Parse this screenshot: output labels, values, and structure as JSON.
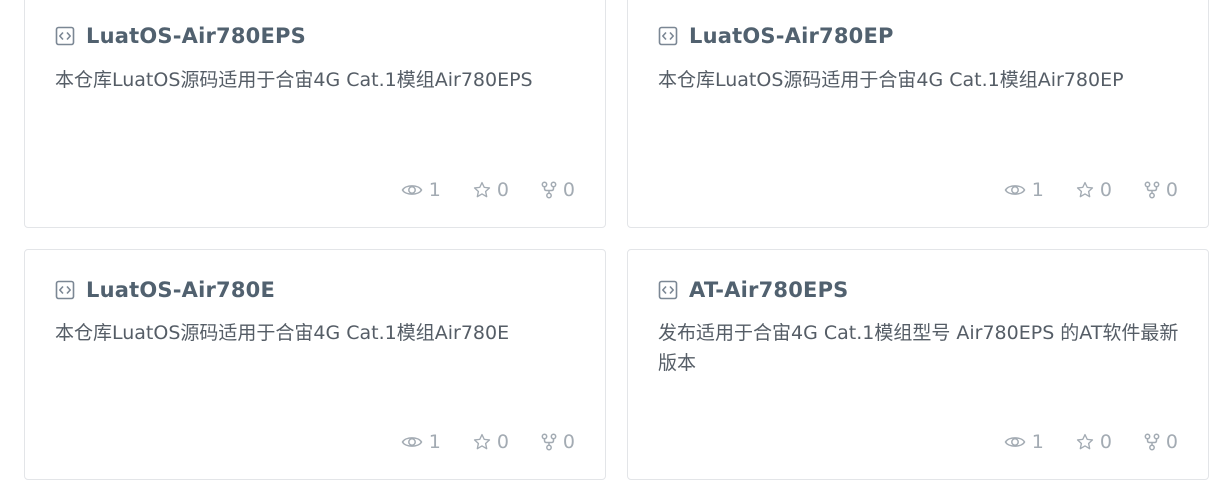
{
  "repos": [
    {
      "name": "LuatOS-Air780EPS",
      "description": "本仓库LuatOS源码适用于合宙4G Cat.1模组Air780EPS",
      "watchers": "1",
      "stars": "0",
      "forks": "0"
    },
    {
      "name": "LuatOS-Air780EP",
      "description": "本仓库LuatOS源码适用于合宙4G Cat.1模组Air780EP",
      "watchers": "1",
      "stars": "0",
      "forks": "0"
    },
    {
      "name": "LuatOS-Air780E",
      "description": "本仓库LuatOS源码适用于合宙4G Cat.1模组Air780E",
      "watchers": "1",
      "stars": "0",
      "forks": "0"
    },
    {
      "name": "AT-Air780EPS",
      "description": "发布适用于合宙4G Cat.1模组型号 Air780EPS 的AT软件最新版本",
      "watchers": "1",
      "stars": "0",
      "forks": "0"
    }
  ],
  "colors": {
    "title": "#51616f",
    "text": "#555d66",
    "muted": "#a3abb3",
    "border": "#e3e5e8"
  },
  "icons": {
    "repo": "code-repo-icon",
    "watch": "eye-icon",
    "star": "star-icon",
    "fork": "fork-icon"
  }
}
